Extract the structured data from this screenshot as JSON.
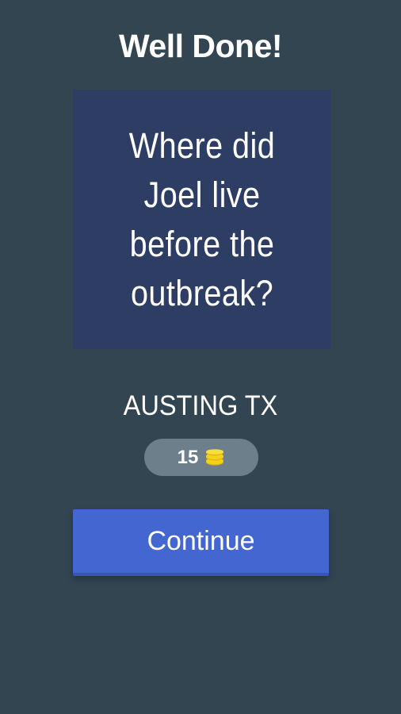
{
  "header": {
    "title": "Well Done!"
  },
  "question": {
    "text": "Where did Joel live before the outbreak?"
  },
  "answer": {
    "text": "AUSTING TX"
  },
  "reward": {
    "amount": "15",
    "icon": "coins-icon"
  },
  "actions": {
    "continue_label": "Continue"
  },
  "colors": {
    "background": "#324551",
    "card": "#2d3d64",
    "pill": "#6c7f8b",
    "button": "#4466d0",
    "coin": "#f5d21a"
  }
}
